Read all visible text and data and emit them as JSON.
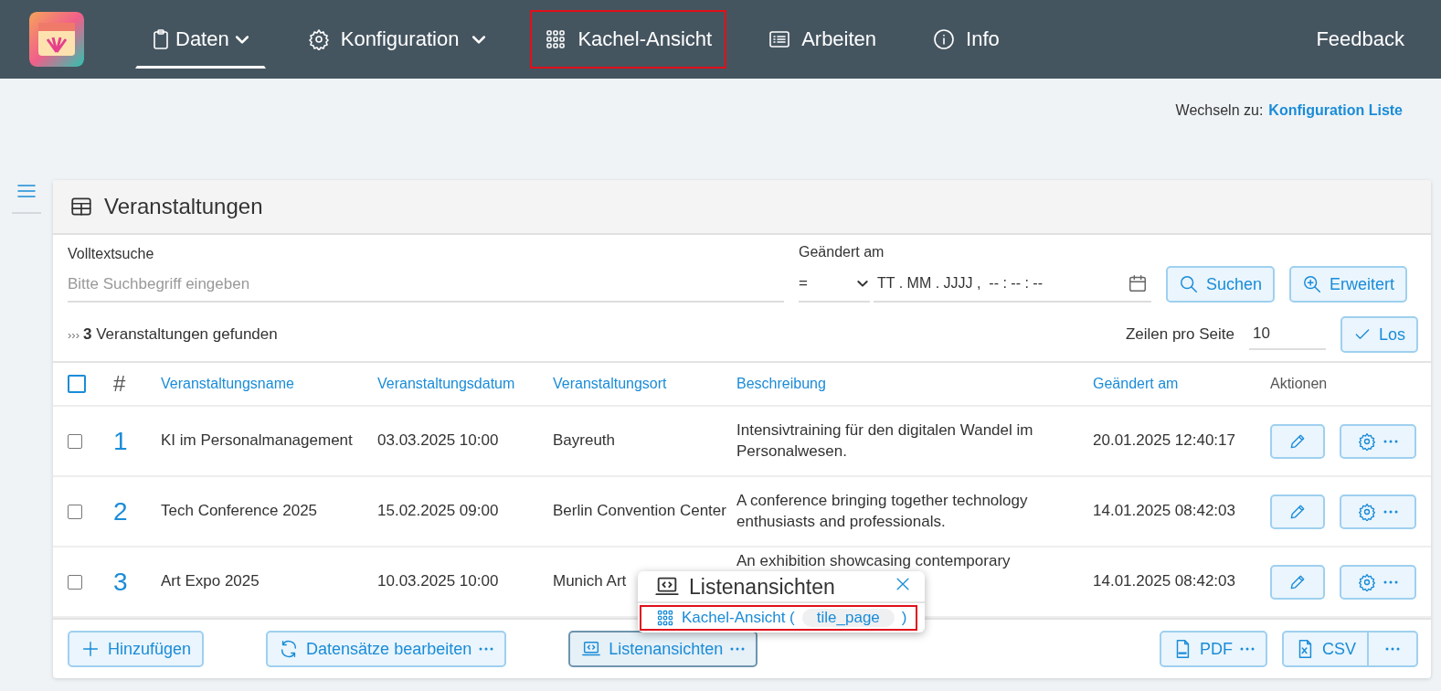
{
  "nav": {
    "items": [
      {
        "label": "Daten",
        "dropdown": true,
        "selected": true,
        "highlighted": false
      },
      {
        "label": "Konfiguration",
        "dropdown": true,
        "selected": false,
        "highlighted": false
      },
      {
        "label": "Kachel-Ansicht",
        "dropdown": false,
        "selected": false,
        "highlighted": true
      },
      {
        "label": "Arbeiten",
        "dropdown": false,
        "selected": false,
        "highlighted": false
      },
      {
        "label": "Info",
        "dropdown": false,
        "selected": false,
        "highlighted": false
      }
    ],
    "feedback": "Feedback"
  },
  "switch": {
    "label": "Wechseln zu:",
    "link": "Konfiguration Liste"
  },
  "card": {
    "title": "Veranstaltungen",
    "search": {
      "label": "Volltextsuche",
      "placeholder": "Bitte Suchbegriff eingeben"
    },
    "changed": {
      "label": "Geändert am",
      "operator": "=",
      "placeholder": "TT . MM . JJJJ ,  -- : -- : --"
    },
    "buttons": [
      "Suchen",
      "Erweitert"
    ],
    "result": {
      "prefix": "›››",
      "text": "**3** Veranstaltungen gefunden"
    },
    "rows_per_page": {
      "label": "Zeilen pro Seite",
      "value": "10",
      "button": "Los"
    },
    "table": {
      "columns": [
        "#",
        "Veranstaltungsname",
        "Veranstaltungsdatum",
        "Veranstaltungsort",
        "Beschreibung",
        "Geändert am",
        "Aktionen"
      ],
      "all_checked": false,
      "rows": [
        {
          "checked": false,
          "num": "1",
          "name": "KI im Personalmanagement",
          "date": "03.03.2025 10:00",
          "place": "Bayreuth",
          "description": "Intensivtraining für den digitalen Wandel im Personalwesen.",
          "changed": "20.01.2025 12:40:17"
        },
        {
          "checked": false,
          "num": "2",
          "name": "Tech Conference 2025",
          "date": "15.02.2025 09:00",
          "place": "Berlin Convention Center",
          "description": "A conference bringing together technology enthusiasts and professionals.",
          "changed": "14.01.2025 08:42:03"
        },
        {
          "checked": false,
          "num": "3",
          "name": "Art Expo 2025",
          "date": "10.03.2025 10:00",
          "place": "Munich Art",
          "description": "An exhibition showcasing contemporary",
          "changed": "14.01.2025 08:42:03"
        }
      ]
    },
    "footer": [
      {
        "label": "Hinzufügen",
        "more": false,
        "pressed": false
      },
      {
        "label": "Datensätze bearbeiten",
        "more": true,
        "pressed": false
      },
      {
        "label": "Listenansichten",
        "more": true,
        "pressed": true
      },
      {
        "label": "PDF",
        "more": true,
        "pressed": false
      },
      {
        "label": "CSV",
        "more": false,
        "pressed": false
      }
    ],
    "popover": {
      "title": "Listenansichten",
      "item": {
        "label": "Kachel-Ansicht (",
        "code": "tile_page",
        "suffix": ")",
        "highlighted": true
      }
    }
  }
}
